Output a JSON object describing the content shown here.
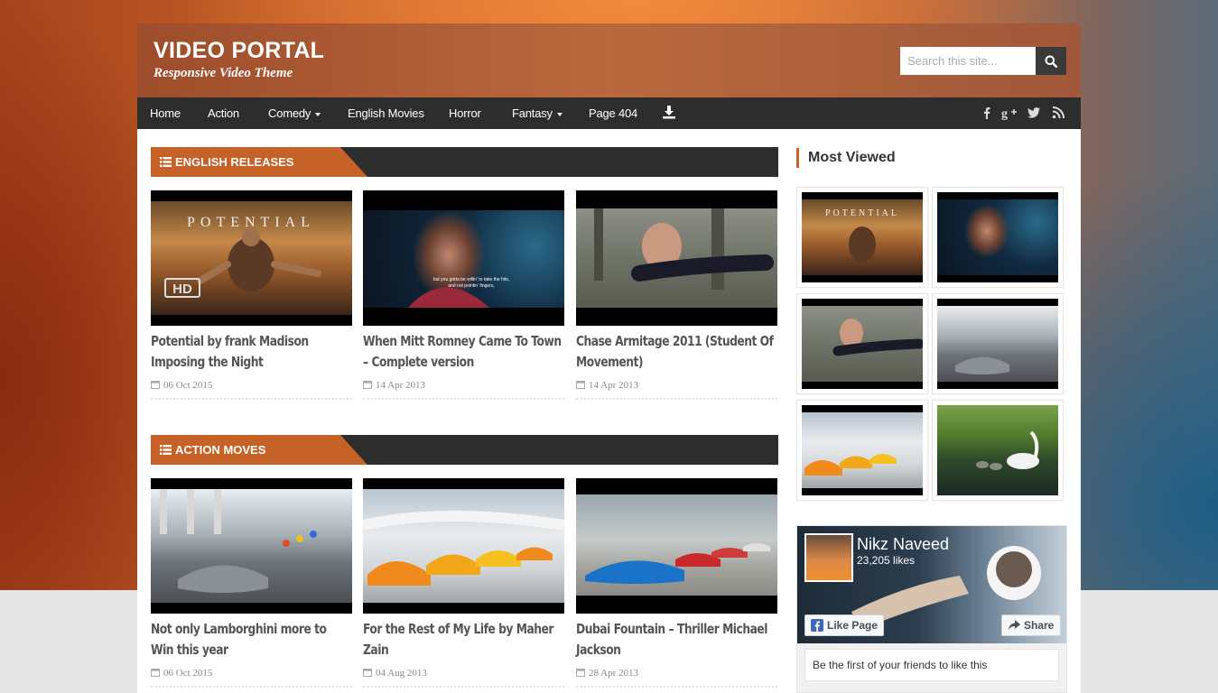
{
  "header": {
    "title": "VIDEO PORTAL",
    "tagline": "Responsive Video Theme",
    "search_placeholder": "Search this site..."
  },
  "nav": {
    "items": [
      "Home",
      "Action",
      "Comedy",
      "English Movies",
      "Horror",
      "Fantasy",
      "Page 404"
    ],
    "social_icons": [
      "facebook-icon",
      "google-plus-icon",
      "twitter-icon",
      "rss-icon"
    ]
  },
  "sections": [
    {
      "title": "ENGLISH RELEASES",
      "posts": [
        {
          "title": "Potential by frank Madison Imposing the Night",
          "date": "06 Oct 2015"
        },
        {
          "title": "When Mitt Romney Came To Town – Complete version",
          "date": "14 Apr 2013"
        },
        {
          "title": "Chase Armitage 2011 (Student Of Movement)",
          "date": "14 Apr 2013"
        }
      ]
    },
    {
      "title": "ACTION MOVES",
      "posts": [
        {
          "title": "Not only Lamborghini more to Win this year",
          "date": "06 Oct 2015"
        },
        {
          "title": "For the Rest of My Life by Maher Zain",
          "date": "04 Aug 2013"
        },
        {
          "title": "Dubai Fountain – Thriller Michael Jackson",
          "date": "28 Apr 2013"
        }
      ]
    }
  ],
  "sidebar": {
    "most_viewed_title": "Most Viewed",
    "facebook": {
      "page_name": "Nikz Naveed",
      "likes": "23,205 likes",
      "like_label": "Like Page",
      "share_label": "Share",
      "friends_text": "Be the first of your friends to like this"
    }
  },
  "colors": {
    "accent": "#c66128",
    "nav_bg": "#2d2d2d",
    "title_text": "#555555"
  }
}
